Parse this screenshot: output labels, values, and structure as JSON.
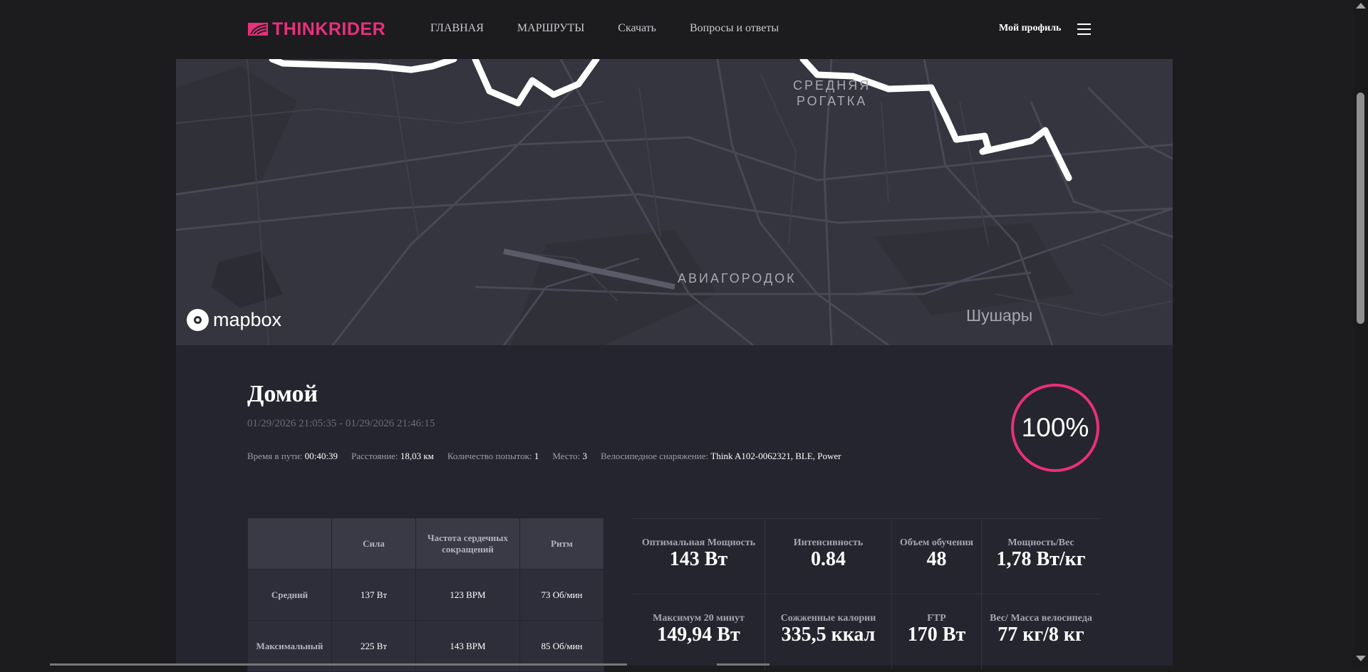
{
  "header": {
    "logo_text": "THINKRIDER",
    "nav": [
      "ГЛАВНАЯ",
      "МАРШРУТЫ",
      "Скачать",
      "Вопросы и ответы"
    ],
    "profile_label": "Мой профиль",
    "accent_color": "#e8307a"
  },
  "map": {
    "labels": {
      "srednyaya_1": "СРЕДНЯЯ",
      "srednyaya_2": "РОГАТКА",
      "aviagorodok": "АВИАГОРОДОК",
      "shushary": "Шушары"
    },
    "attribution": "mapbox"
  },
  "ride": {
    "title": "Домой",
    "date_range": "01/29/2026 21:05:35 - 01/29/2026 21:46:15",
    "completion": "100%",
    "stats": [
      {
        "label": "Время в пути:",
        "value": "00:40:39"
      },
      {
        "label": "Расстояние:",
        "value": "18,03 км"
      },
      {
        "label": "Количество попыток:",
        "value": "1"
      },
      {
        "label": "Место:",
        "value": "3"
      },
      {
        "label": "Велосипедное снаряжение:",
        "value": "Think A102-0062321, BLE, Power"
      }
    ]
  },
  "table": {
    "headers": [
      "",
      "Сила",
      "Частота сердечных сокращений",
      "Ритм"
    ],
    "rows": [
      {
        "label": "Средний",
        "cells": [
          "137 Вт",
          "123 BPM",
          "73 Об/мин"
        ]
      },
      {
        "label": "Максимальный",
        "cells": [
          "225 Вт",
          "143 BPM",
          "85 Об/мин"
        ]
      }
    ]
  },
  "metrics": {
    "row1": [
      {
        "label": "Оптимальная Мощность",
        "value": "143 Вт"
      },
      {
        "label": "Интенсивность",
        "value": "0.84"
      },
      {
        "label": "Объем обучения",
        "value": "48"
      },
      {
        "label": "Мощность/Вес",
        "value": "1,78 Вт/кг"
      }
    ],
    "row2": [
      {
        "label": "Максимум 20 минут",
        "value": "149,94 Вт"
      },
      {
        "label": "Сожженные калории",
        "value": "335,5 ккал"
      },
      {
        "label": "FTP",
        "value": "170 Вт"
      },
      {
        "label": "Вес/ Масса велосипеда",
        "value": "77 кг/8 кг"
      }
    ]
  }
}
